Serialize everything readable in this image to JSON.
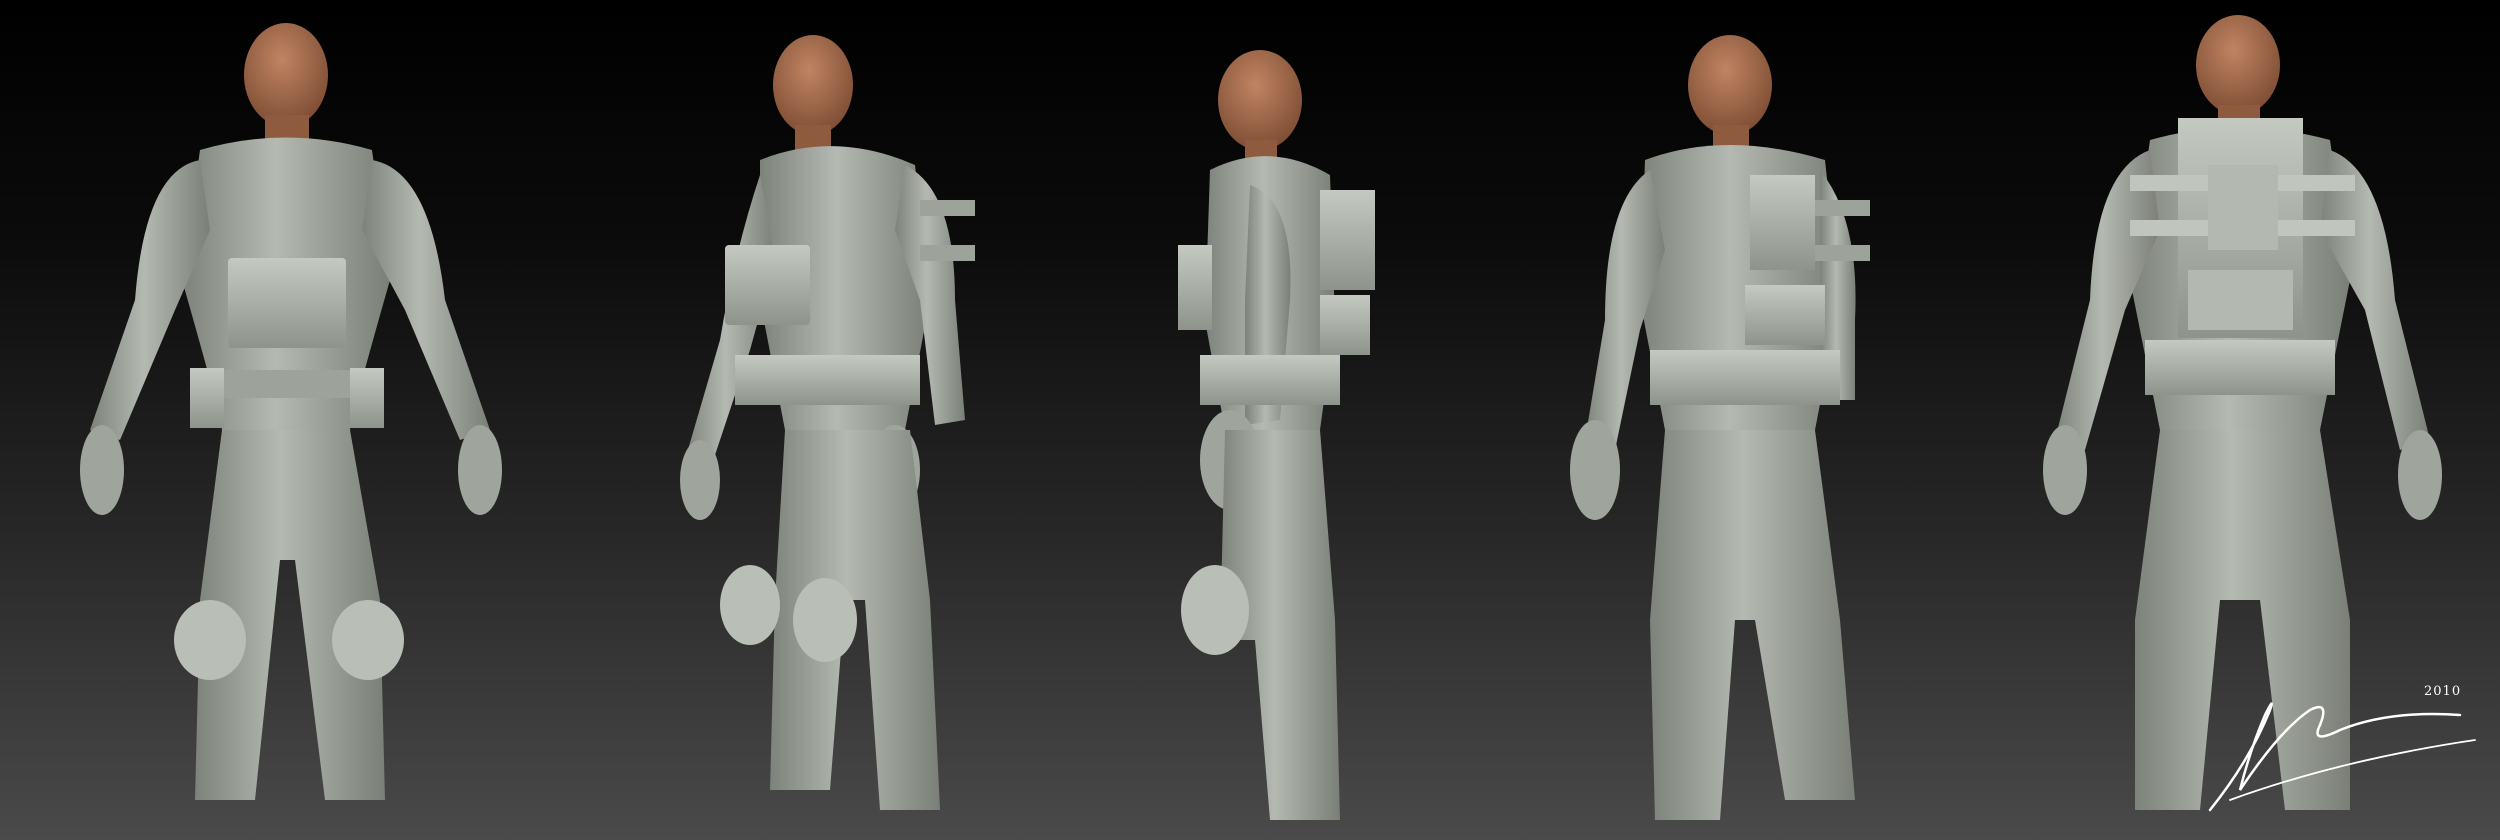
{
  "scene": {
    "background_top": "#000000",
    "background_bottom": "#4a4a4a",
    "suit_color": "#a9aea6",
    "suit_shadow": "#6f746d",
    "gear_color": "#b7bcb4",
    "skin_color": "#a56d4c",
    "views": [
      "front",
      "three-quarter-front",
      "side",
      "three-quarter-back",
      "back"
    ]
  },
  "signature": {
    "year": "2010",
    "color": "#ffffff"
  }
}
